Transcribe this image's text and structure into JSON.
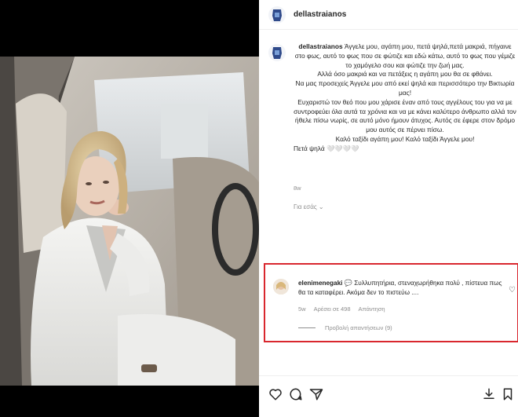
{
  "post": {
    "username": "dellastraianos",
    "caption_user": "dellastraianos",
    "caption_lines": [
      "Άγγελε μου, αγάπη μου, πετά ψηλά,πετά μακριά, πήγαινε στο φως, αυτό το φως που σε φώτιζε και εδώ κάτω, αυτό το φως που γέμιζε το χαμόγελο σου και φώτιζε την ζωή μας.",
      "Αλλά όσο μακριά και να πετάξεις η αγάπη μου θα σε φθάνει.",
      "Να μας προσεχείς Άγγελε μου από εκεί ψηλά και περισσότερο την Βικτωρία μας!",
      "Ευχαριστώ τον θεό που μου χάρισε έναν από τους αγγέλους του για να με συντροφεύει όλα αυτά τα χρόνια και να με κάνει καλύτερο άνθρωπο αλλά τον ήθελε πίσω νωρίς, σε αυτό μόνο ήμουν άτυχος. Αυτός σε έφερε στον δρόμο μου αυτός σε πέρνει πίσω.",
      "Καλό ταξίδι αγάπη μου! Καλό ταξίδι Άγγελε μου!",
      "Πετά ψηλά �once"
    ],
    "time_ago": "8w",
    "translate_label": "Για εσάς ⌄"
  },
  "comment": {
    "username": "elenimenegaki",
    "text": "💬 Συλλυπητήρια, στεναχωρήθηκα πολύ , πίστευα πως θα τα καταφέρει. Ακόμα δεν το πιστεύω ....",
    "time_ago": "5w",
    "likes_label": "Αρέσει σε 498",
    "reply_label": "Απάντηση",
    "view_replies_label": "Προβολή απαντήσεων (9)",
    "highlight_color": "#d9272e"
  },
  "actions": {
    "icons": [
      "heart-icon",
      "comment-icon",
      "share-icon",
      "download-icon",
      "bookmark-icon"
    ]
  }
}
